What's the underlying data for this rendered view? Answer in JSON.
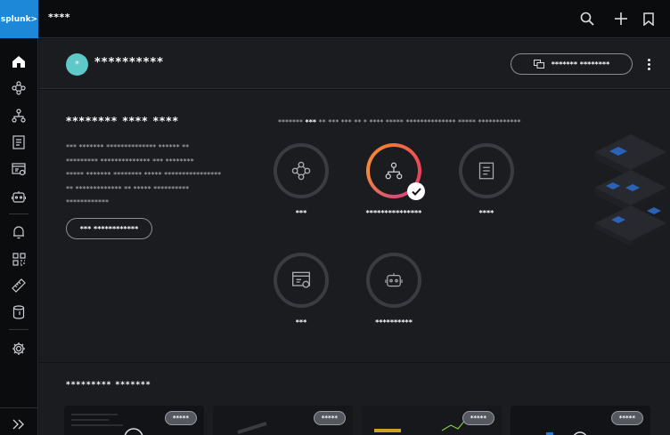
{
  "app": {
    "logo_text": "splunk>",
    "title": "****"
  },
  "topbar": {
    "icons": [
      "search-icon",
      "plus-icon",
      "bookmark-icon"
    ]
  },
  "sidenav": {
    "items": [
      "home-icon",
      "workflow-icon",
      "hierarchy-icon",
      "document-icon",
      "dashboard-icon",
      "robot-icon",
      "bell-icon",
      "apps-grid-icon",
      "ruler-icon",
      "database-icon",
      "gear-icon"
    ],
    "expand_icon": "double-chevron-right-icon"
  },
  "header": {
    "avatar_initial": "*",
    "user_name": "**********",
    "switch_button_label": "******* ********"
  },
  "welcome": {
    "title": "******** **** ****",
    "description_lines": [
      "*** ******* ************** ****** **",
      "********* ************** *** ********",
      "***** ******* ******** ***** ****************",
      "** ************* ** ***** **********",
      "************"
    ],
    "learn_button_label": "*** ************",
    "tagline_pre": "******* ",
    "tagline_bold": "***",
    "tagline_post": " ** *** *** ** * **** ***** ************** ***** ************"
  },
  "experiences": [
    {
      "name": "***",
      "icon": "workflow-icon",
      "selected": false
    },
    {
      "name": "***************",
      "icon": "hierarchy-icon",
      "selected": true
    },
    {
      "name": "****",
      "icon": "document-icon",
      "selected": false
    },
    {
      "name": "***",
      "icon": "dashboard-icon",
      "selected": false
    },
    {
      "name": "**********",
      "icon": "robot-icon",
      "selected": false
    }
  ],
  "spotlight": {
    "title": "********* *******",
    "cards": [
      {
        "badge": "*****"
      },
      {
        "badge": "*****"
      },
      {
        "badge": "*****"
      },
      {
        "badge": "*****"
      }
    ]
  },
  "colors": {
    "brand": "#1e88d8",
    "avatar": "#5fc8c8",
    "accent_start": "#f4743b",
    "accent_end": "#e94260"
  }
}
